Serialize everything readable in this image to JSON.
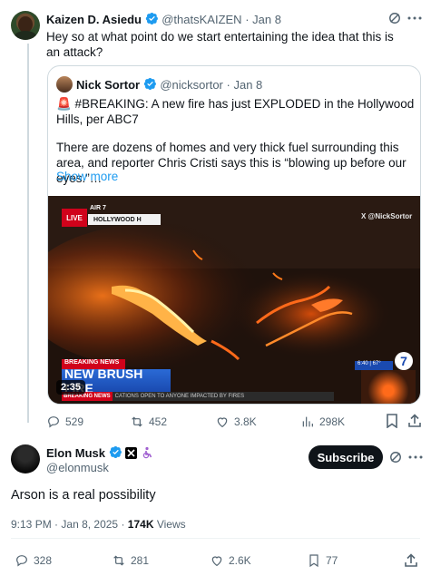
{
  "reply_tweet": {
    "author_name": "Kaizen D. Asiedu",
    "handle": "@thatsKAIZEN",
    "dot": "·",
    "date": "Jan 8",
    "text": "Hey so at what point do we start entertaining the idea that this is an attack?",
    "quote": {
      "author_name": "Nick Sortor",
      "handle": "@nicksortor",
      "dot": "·",
      "date": "Jan 8",
      "line1": "🚨 #BREAKING: A new fire has just EXPLODED in the Hollywood Hills, per ABC7",
      "line2": "There are dozens of homes and very thick fuel surrounding this area, and reporter Chris Cristi says this is “blowing up before our eyes.”…",
      "show_more": "Show more",
      "video": {
        "live": "LIVE",
        "air": "AIR 7",
        "location": "HOLLYWOOD H",
        "watermark": "X @NickSortor",
        "breaking": "BREAKING NEWS",
        "headline": "NEW BRUSH FIRE",
        "ticker_tag": "BREAKING NEWS",
        "ticker": "CATIONS OPEN TO ANYONE IMPACTED BY FIRES",
        "time_tag": "6:40 | 67°",
        "logo": "7",
        "duration": "2:35"
      }
    },
    "stats": {
      "replies": "529",
      "retweets": "452",
      "likes": "3.8K",
      "views": "298K"
    }
  },
  "main_tweet": {
    "author_name": "Elon Musk",
    "handle": "@elonmusk",
    "subscribe_label": "Subscribe",
    "text": "Arson is a real possibility",
    "time": "9:13 PM",
    "dot": "·",
    "date": "Jan 8, 2025",
    "dot2": "·",
    "views_count": "174K",
    "views_label": "Views",
    "stats": {
      "replies": "328",
      "retweets": "281",
      "likes": "2.6K",
      "bookmarks": "77"
    }
  },
  "colors": {
    "verified": "#1d9bf0",
    "text": "#0f1419",
    "muted": "#536471",
    "link": "#1d9bf0",
    "border": "#cfd9de"
  }
}
